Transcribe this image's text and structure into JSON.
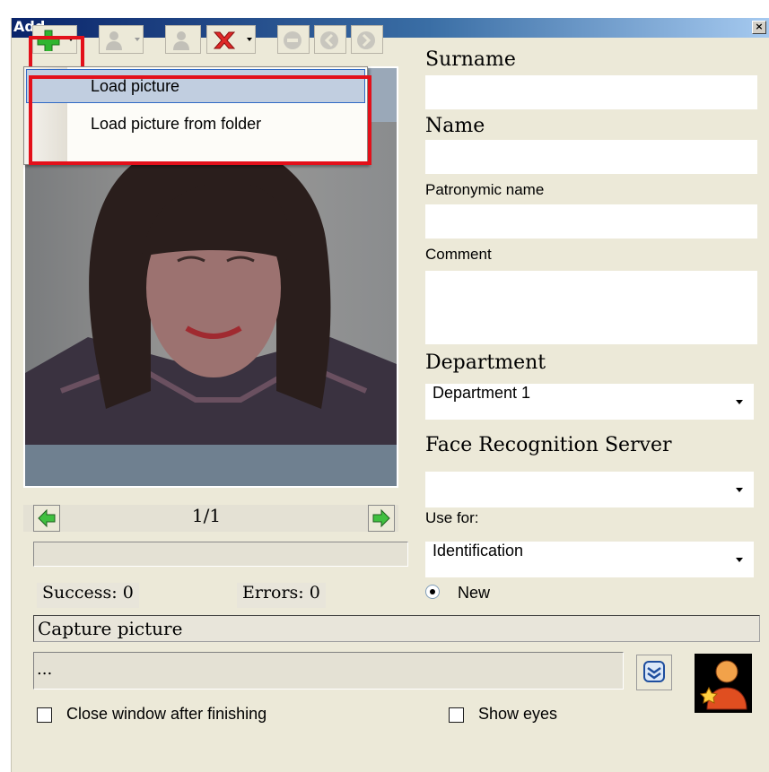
{
  "window": {
    "title": "Add",
    "close_glyph": "×"
  },
  "toolbar": {
    "buttons": [
      {
        "icon": "add-icon",
        "enabled": true,
        "has_dropdown": true
      },
      {
        "icon": "user-dropdown-icon",
        "enabled": false,
        "has_dropdown": true
      },
      {
        "icon": "user-icon",
        "enabled": false,
        "has_dropdown": false
      },
      {
        "icon": "delete-icon",
        "enabled": true,
        "has_dropdown": true
      },
      {
        "icon": "minus-circle-icon",
        "enabled": false,
        "has_dropdown": false
      },
      {
        "icon": "back-circle-icon",
        "enabled": false,
        "has_dropdown": false
      },
      {
        "icon": "forward-circle-icon",
        "enabled": false,
        "has_dropdown": false
      }
    ]
  },
  "menu": {
    "items": [
      {
        "label": "Load picture",
        "selected": true
      },
      {
        "label": "Load picture from folder",
        "selected": false
      }
    ]
  },
  "pager": {
    "counter": "1/1"
  },
  "stats": {
    "success": "Success: 0",
    "errors": "Errors: 0"
  },
  "form": {
    "surname_label": "Surname",
    "surname_value": "",
    "name_label": "Name",
    "name_value": "",
    "patronymic_label": "Patronymic name",
    "patronymic_value": "",
    "comment_label": "Comment",
    "comment_value": "",
    "department_label": "Department",
    "department_value": "Department 1",
    "server_label": "Face Recognition Server",
    "server_value": "",
    "use_for_label": "Use for:",
    "use_for_value": "Identification",
    "new_label": "New",
    "new_checked": true
  },
  "capture": {
    "title": "Capture picture",
    "path": "..."
  },
  "options": {
    "close_after_label": "Close window after finishing",
    "close_after_checked": false,
    "show_eyes_label": "Show eyes",
    "show_eyes_checked": false
  },
  "colors": {
    "highlight_red": "#e3101a",
    "title_blue": "#0a246a",
    "menu_selected": "#c1cee0"
  }
}
